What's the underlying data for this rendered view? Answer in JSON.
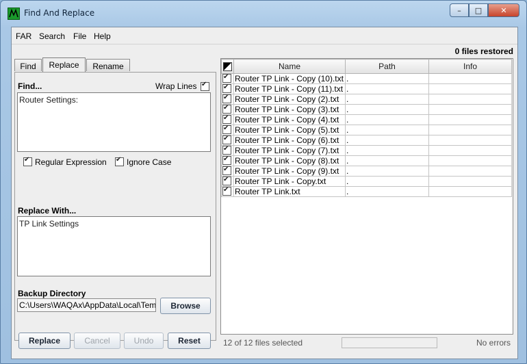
{
  "window": {
    "title": "Find And Replace",
    "minimize": "–",
    "maximize": "□",
    "close": "✕"
  },
  "menu": {
    "far": "FAR",
    "search": "Search",
    "file": "File",
    "help": "Help"
  },
  "header": {
    "files_restored": "0 files restored"
  },
  "tabs": {
    "find": "Find",
    "replace": "Replace",
    "rename": "Rename"
  },
  "find": {
    "label": "Find...",
    "wrap_lines_label": "Wrap Lines",
    "wrap_lines_checked": true,
    "text": "Router Settings:",
    "regex_label": "Regular Expression",
    "regex_checked": true,
    "ignore_case_label": "Ignore Case",
    "ignore_case_checked": true
  },
  "replace_with": {
    "label": "Replace With...",
    "text": "TP Link Settings"
  },
  "backup": {
    "label": "Backup Directory",
    "path": "C:\\Users\\WAQAx\\AppData\\Local\\Temp",
    "browse": "Browse"
  },
  "buttons": {
    "replace": "Replace",
    "cancel": "Cancel",
    "undo": "Undo",
    "reset": "Reset"
  },
  "table": {
    "columns": [
      "Name",
      "Path",
      "Info"
    ],
    "rows": [
      {
        "name": "Router TP Link - Copy (10).txt",
        "path": ".",
        "info": ""
      },
      {
        "name": "Router TP Link - Copy (11).txt",
        "path": ".",
        "info": ""
      },
      {
        "name": "Router TP Link - Copy (2).txt",
        "path": ".",
        "info": ""
      },
      {
        "name": "Router TP Link - Copy (3).txt",
        "path": ".",
        "info": ""
      },
      {
        "name": "Router TP Link - Copy (4).txt",
        "path": ".",
        "info": ""
      },
      {
        "name": "Router TP Link - Copy (5).txt",
        "path": ".",
        "info": ""
      },
      {
        "name": "Router TP Link - Copy (6).txt",
        "path": ".",
        "info": ""
      },
      {
        "name": "Router TP Link - Copy (7).txt",
        "path": ".",
        "info": ""
      },
      {
        "name": "Router TP Link - Copy (8).txt",
        "path": ".",
        "info": ""
      },
      {
        "name": "Router TP Link - Copy (9).txt",
        "path": ".",
        "info": ""
      },
      {
        "name": "Router TP Link - Copy.txt",
        "path": ".",
        "info": ""
      },
      {
        "name": "Router TP Link.txt",
        "path": ".",
        "info": ""
      }
    ]
  },
  "status": {
    "selected": "12 of 12 files selected",
    "errors": "No errors"
  }
}
